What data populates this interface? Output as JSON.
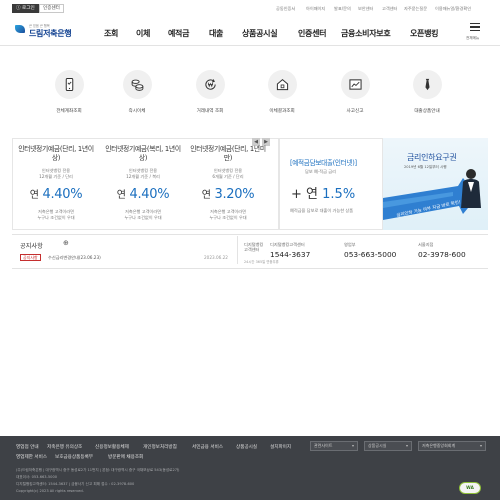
{
  "topbar": {
    "buttons": [
      "ⓘ 로그인",
      "인증센터"
    ],
    "links": [
      "공동인증서",
      "아이패이지",
      "발표/문의",
      "보안센터",
      "고객센터",
      "자주묻는질문",
      "이용매뉴얼/환경확인"
    ]
  },
  "header": {
    "logo_sub": "큰 믿음 큰 행복",
    "logo_text": "드림저축은행",
    "nav": [
      "조회",
      "이체",
      "예적금",
      "대출",
      "상품공시실",
      "인증센터",
      "금융소비자보호",
      "오픈뱅킹"
    ],
    "menu_label": "전체메뉴"
  },
  "quick_menu": [
    {
      "label": "전체계좌조회",
      "icon": "phone-icon"
    },
    {
      "label": "즉시이체",
      "icon": "coins-icon"
    },
    {
      "label": "거래내역 조회",
      "icon": "won-refresh-icon"
    },
    {
      "label": "이체결과조회",
      "icon": "house-icon"
    },
    {
      "label": "사고신고",
      "icon": "chart-card-icon"
    },
    {
      "label": "대출상품안내",
      "icon": "tie-icon"
    }
  ],
  "products": [
    {
      "title": "인터넷정기예금(단리, 1년이상)",
      "desc": [
        "인터넷뱅킹 전용",
        "12개월 기준 / 단리"
      ],
      "rate_prefix": "연",
      "rate": "4.40%",
      "foot": [
        "저축은행 고객이라면",
        "누구나 조건없이 우대"
      ]
    },
    {
      "title": "인터넷정기예금(복리, 1년이상)",
      "desc": [
        "인터넷뱅킹 전용",
        "12개월 기준 / 복리"
      ],
      "rate_prefix": "연",
      "rate": "4.40%",
      "foot": [
        "저축은행 고객이라면",
        "누구나 조건없이 우대"
      ]
    },
    {
      "title": "인터넷정기예금(단리, 1년미만)",
      "desc": [
        "인터넷뱅킹 전용",
        "6개월 기준 / 단리"
      ],
      "rate_prefix": "연",
      "rate": "3.20%",
      "foot": [
        "저축은행 고객이라면",
        "누구나 조건없이 우대"
      ]
    }
  ],
  "pager": [
    "◀",
    "▶"
  ],
  "promo": {
    "title": "[예적금담보대출(인터넷)]",
    "sub": "담보 예·적금 금리",
    "rate_prefix": "+ 연",
    "rate": "1.5%",
    "foot": "예적금을 담보로 대출이 가능한 상품"
  },
  "banner": {
    "title": "금리인하요구권",
    "date": "2019년 6월 12일부터 시행",
    "ribbon": "금리인하 가능 여부 지금 바로 확인!"
  },
  "notice": {
    "heading": "공지사항",
    "plus": "⊕",
    "badge": "공지사항",
    "text": "수신금리변경안내(23.06.23)",
    "date": "2023.06.22"
  },
  "contacts": [
    {
      "title": [
        "디지털뱅킹",
        "고객센터"
      ],
      "number": "1544-3637"
    },
    {
      "title": [
        "디지털뱅킹고객센터"
      ],
      "number": ""
    },
    {
      "title": [
        "영업부"
      ],
      "number": "053-663-5000"
    },
    {
      "title": [
        "서울지점"
      ],
      "number": "02-3978-600"
    }
  ],
  "contact_note": "24시간 365일 연중무휴",
  "footer": {
    "links_row1": [
      "영업점 안내",
      "저축은행 유의상조",
      "신용정보활용체제",
      "개인정보처리방침",
      "서민금융 서비스",
      "상품공시실",
      "설치파이지"
    ],
    "links_row2": [
      "영업제한 서비스",
      "보호금융상품등록부",
      "방문판매 채용조회"
    ],
    "selects": [
      "관련사이트",
      "상품공시실",
      "저축은행중앙회회계"
    ],
    "address_lines": [
      "(주)드림저축은행 | 대구광역시 중구 동성로2가 11번지 | 본점: 대구광역시 중구 국채보상로 543(동성로2가)",
      "대표이사: 053-663-5000",
      "디지털뱅킹고객센터: 1544-3637 | 금융사기 신고 피해 접수 : 02-3978-600",
      "Copyright(c) 2023 All rights reserved."
    ],
    "badge": "WA"
  }
}
